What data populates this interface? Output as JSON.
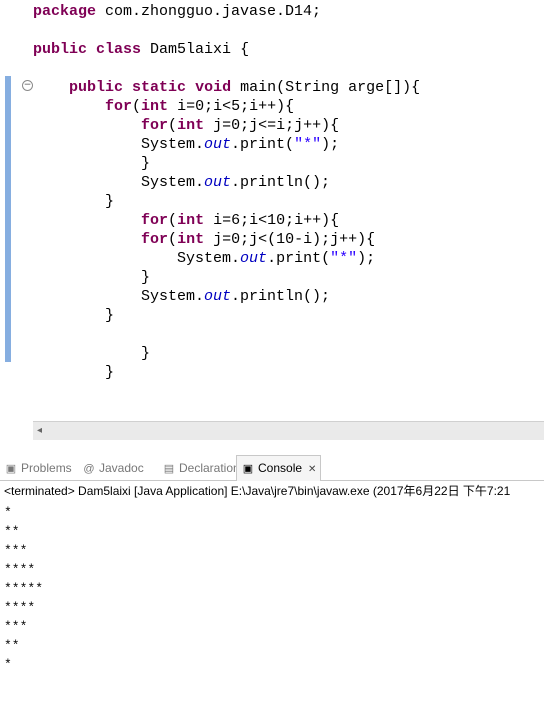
{
  "editor": {
    "lines": [
      {
        "parts": [
          {
            "t": "package",
            "c": "kw"
          },
          {
            "t": " com.zhongguo.javase.D14;"
          }
        ]
      },
      {
        "parts": [
          {
            "t": ""
          }
        ]
      },
      {
        "parts": [
          {
            "t": "public",
            "c": "kw"
          },
          {
            "t": " "
          },
          {
            "t": "class",
            "c": "kw"
          },
          {
            "t": " Dam5laixi {"
          }
        ]
      },
      {
        "parts": [
          {
            "t": ""
          }
        ]
      },
      {
        "parts": [
          {
            "t": "    "
          },
          {
            "t": "public",
            "c": "kw"
          },
          {
            "t": " "
          },
          {
            "t": "static",
            "c": "kw"
          },
          {
            "t": " "
          },
          {
            "t": "void",
            "c": "kw"
          },
          {
            "t": " main(String arge[]){"
          }
        ]
      },
      {
        "parts": [
          {
            "t": "        "
          },
          {
            "t": "for",
            "c": "kw"
          },
          {
            "t": "("
          },
          {
            "t": "int",
            "c": "kw"
          },
          {
            "t": " i=0;i<5;i++){"
          }
        ]
      },
      {
        "parts": [
          {
            "t": "            "
          },
          {
            "t": "for",
            "c": "kw"
          },
          {
            "t": "("
          },
          {
            "t": "int",
            "c": "kw"
          },
          {
            "t": " j=0;j<=i;j++){"
          }
        ]
      },
      {
        "parts": [
          {
            "t": "            System."
          },
          {
            "t": "out",
            "c": "fld"
          },
          {
            "t": ".print("
          },
          {
            "t": "\"*\"",
            "c": "str"
          },
          {
            "t": ");"
          }
        ]
      },
      {
        "parts": [
          {
            "t": "            }"
          }
        ]
      },
      {
        "parts": [
          {
            "t": "            System."
          },
          {
            "t": "out",
            "c": "fld"
          },
          {
            "t": ".println();"
          }
        ]
      },
      {
        "parts": [
          {
            "t": "        }"
          }
        ]
      },
      {
        "parts": [
          {
            "t": "            "
          },
          {
            "t": "for",
            "c": "kw"
          },
          {
            "t": "("
          },
          {
            "t": "int",
            "c": "kw"
          },
          {
            "t": " i=6;i<10;i++){"
          }
        ]
      },
      {
        "parts": [
          {
            "t": "            "
          },
          {
            "t": "for",
            "c": "kw"
          },
          {
            "t": "("
          },
          {
            "t": "int",
            "c": "kw"
          },
          {
            "t": " j=0;j<(10-i);j++){"
          }
        ]
      },
      {
        "parts": [
          {
            "t": "                System."
          },
          {
            "t": "out",
            "c": "fld"
          },
          {
            "t": ".print("
          },
          {
            "t": "\"*\"",
            "c": "str"
          },
          {
            "t": ");"
          }
        ]
      },
      {
        "parts": [
          {
            "t": "            }"
          }
        ]
      },
      {
        "parts": [
          {
            "t": "            System."
          },
          {
            "t": "out",
            "c": "fld"
          },
          {
            "t": ".println();"
          }
        ]
      },
      {
        "parts": [
          {
            "t": "        }"
          }
        ]
      },
      {
        "parts": [
          {
            "t": ""
          }
        ]
      },
      {
        "parts": [
          {
            "t": "            }"
          }
        ]
      },
      {
        "parts": [
          {
            "t": "        }"
          }
        ]
      }
    ]
  },
  "colors": {
    "keyword": "#7f0055",
    "field": "#0000c0",
    "string": "#2a00ff",
    "ruler_range": "#86aee0"
  },
  "tabs": [
    {
      "label": "Problems",
      "icon": "problems-icon",
      "glyph": "▣",
      "active": false
    },
    {
      "label": "Javadoc",
      "icon": "javadoc-icon",
      "glyph": "@",
      "active": false
    },
    {
      "label": "Declaration",
      "icon": "declaration-icon",
      "glyph": "▤",
      "active": false
    },
    {
      "label": "Console",
      "icon": "console-icon",
      "glyph": "▣",
      "active": true
    }
  ],
  "console": {
    "header": "<terminated> Dam5laixi [Java Application] E:\\Java\\jre7\\bin\\javaw.exe (2017年6月22日 下午7:21",
    "output_lines": [
      "*",
      "**",
      "***",
      "****",
      "*****",
      "****",
      "***",
      "**",
      "*"
    ]
  }
}
